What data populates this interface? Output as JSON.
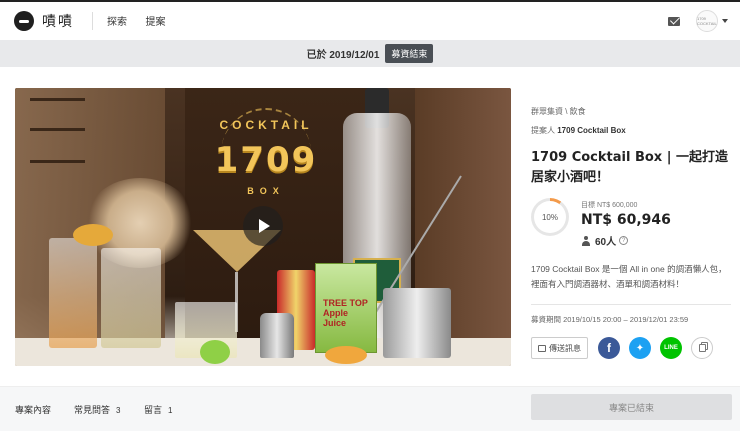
{
  "header": {
    "logo_text": "嘖嘖",
    "nav": [
      "探索",
      "提案"
    ],
    "avatar_text": "1709 COCKTAIL"
  },
  "status": {
    "text": "已於 2019/12/01",
    "badge": "募資結束"
  },
  "media": {
    "brand_top": "COCKTAIL",
    "brand_number": "1709",
    "brand_bottom": "BOX",
    "juice_text": "TREE TOP Apple Juice"
  },
  "project": {
    "category_path": "群眾集資 \\ 飲食",
    "proposer_label": "提案人",
    "proposer_name": "1709 Cocktail Box",
    "title": "1709 Cocktail Box | 一起打造居家小酒吧！",
    "percent": "10%",
    "percent_value": 10,
    "goal": "目標 NT$ 600,000",
    "amount": "NT$ 60,946",
    "backers": "60人",
    "description": "1709 Cocktail Box 是一個 All in one 的調酒懶人包，裡面有入門調酒器材、酒單和調酒材料！",
    "period": "募資期間  2019/10/15 20:00 – 2019/12/01 23:59",
    "message_button": "傳送訊息"
  },
  "tabs": [
    {
      "label": "專案內容",
      "count": ""
    },
    {
      "label": "常見問答",
      "count": "3"
    },
    {
      "label": "留言",
      "count": "1"
    }
  ],
  "cta": {
    "label": "專案已結束"
  },
  "colors": {
    "progress": "#f39a4a",
    "facebook": "#3b5998",
    "twitter": "#1da1f2",
    "line": "#00c300"
  }
}
